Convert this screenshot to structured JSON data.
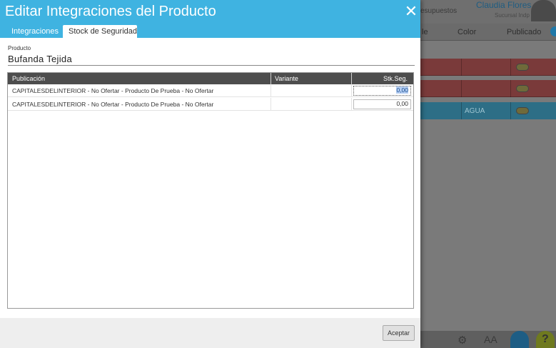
{
  "modal": {
    "title": "Editar Integraciones del Producto",
    "close_glyph": "✕",
    "tabs": [
      {
        "label": "Integraciones",
        "active": false
      },
      {
        "label": "Stock de Seguridad",
        "active": true
      }
    ],
    "product_label": "Producto",
    "product_value": "Bufanda Tejida",
    "table": {
      "headers": [
        "Publicación",
        "Variante",
        "Stk.Seg."
      ],
      "rows": [
        {
          "publicacion": "CAPITALESDELINTERIOR - No Ofertar - Producto De Prueba - No Ofertar",
          "variante": "",
          "stk_seg": "0,00",
          "focused": true
        },
        {
          "publicacion": "CAPITALESDELINTERIOR - No Ofertar - Producto De Prueba - No Ofertar",
          "variante": "",
          "stk_seg": "0,00",
          "focused": false
        }
      ]
    },
    "accept_label": "Aceptar"
  },
  "background": {
    "top_text": "esupuestos",
    "user_name": "Claudia Flores",
    "branch": "Sucursal Indp",
    "headers": [
      "le",
      "Color",
      "Publicado"
    ],
    "row_color_text": "AGUA",
    "bottom_gear": "⚙",
    "bottom_font": "AA",
    "help_glyph": "?"
  },
  "colors": {
    "header_blue": "#3fb3e1",
    "table_header": "#4d4d4d"
  },
  "icons": {
    "close": "close-icon",
    "gear": "gear-icon",
    "font_size": "font-size-icon",
    "help": "help-icon"
  }
}
